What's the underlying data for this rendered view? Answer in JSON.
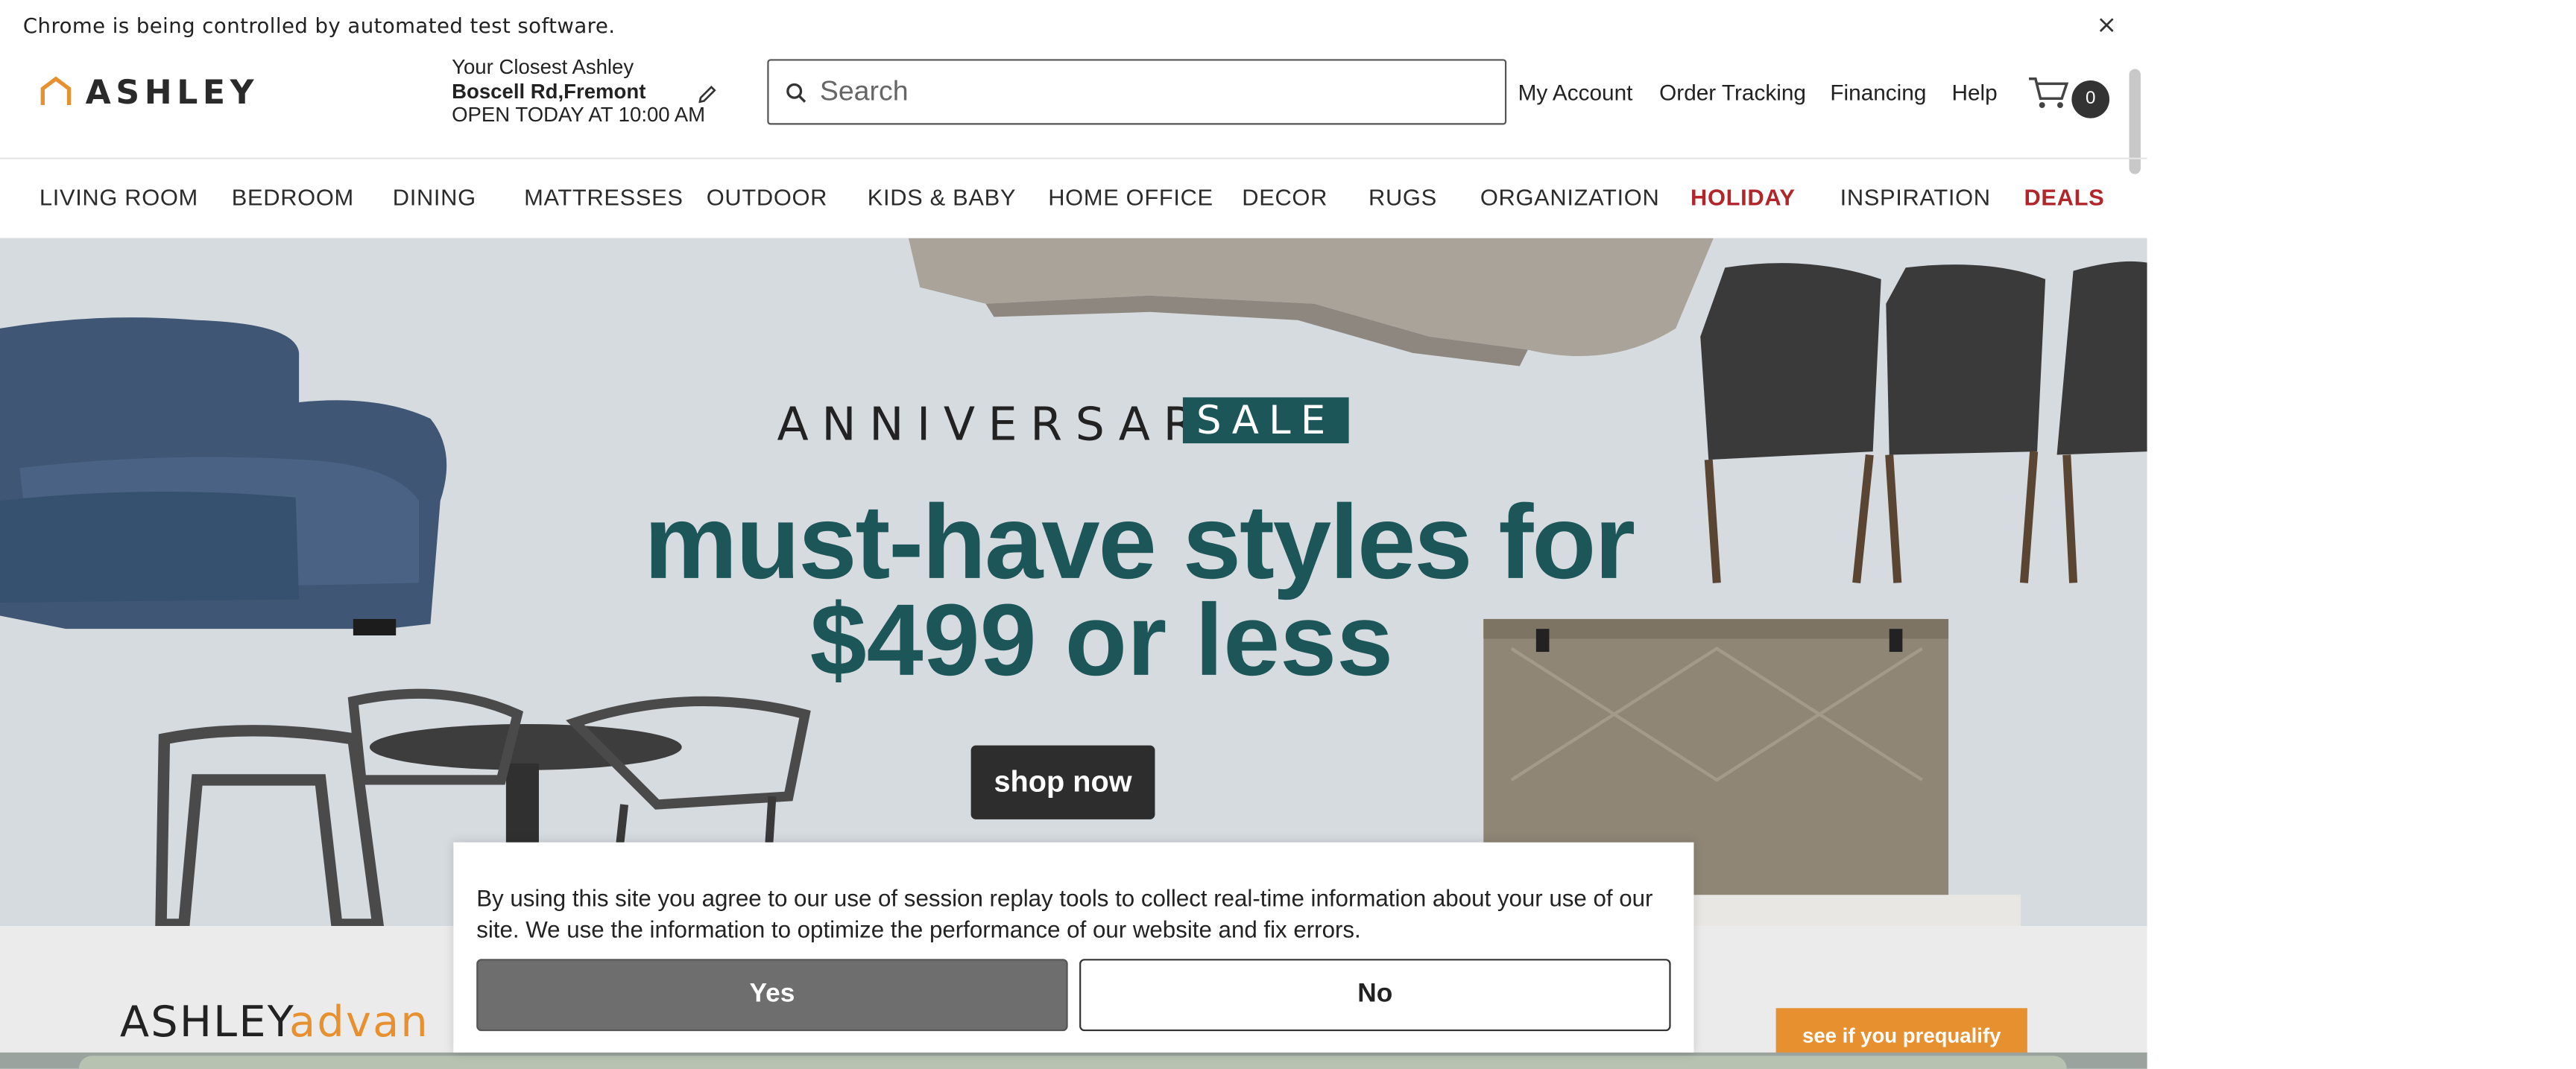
{
  "automation_bar": {
    "message": "Chrome is being controlled by automated test software.",
    "close_glyph": "×"
  },
  "header": {
    "logo_text": "ASHLEY",
    "store": {
      "label": "Your Closest Ashley",
      "name": "Boscell Rd,Fremont",
      "hours": "OPEN TODAY AT 10:00 AM"
    },
    "search_placeholder": "Search",
    "links": [
      "My Account",
      "Order Tracking",
      "Financing",
      "Help"
    ],
    "cart_count": "0"
  },
  "nav": {
    "items": [
      "LIVING ROOM",
      "BEDROOM",
      "DINING",
      "MATTRESSES",
      "OUTDOOR",
      "KIDS & BABY",
      "HOME OFFICE",
      "DECOR",
      "RUGS",
      "ORGANIZATION",
      "HOLIDAY",
      "INSPIRATION",
      "DEALS"
    ],
    "highlight_color": "#b1252b"
  },
  "hero": {
    "eyebrow": "ANNIVERSARY",
    "badge": "SALE",
    "headline_1": "must-have styles for",
    "headline_2": "$499 or less",
    "cta": "shop now",
    "accent_color": "#1c5659"
  },
  "advantage": {
    "brand_a": "ASHLEY",
    "brand_b": "advan",
    "cta": "see if you prequalify",
    "accent_color": "#e7902f"
  },
  "consent": {
    "text": "By using this site you agree to our use of session replay tools to collect real-time information about your use of our site. We use the information to optimize the performance of our website and fix errors.",
    "yes": "Yes",
    "no": "No"
  }
}
